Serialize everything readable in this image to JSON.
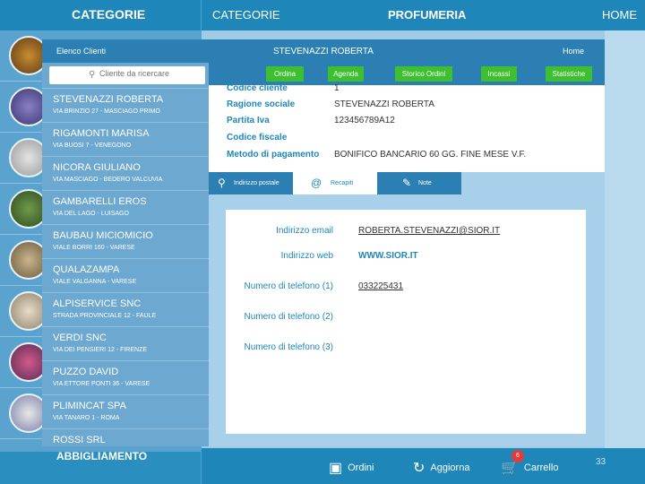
{
  "topbar": {
    "categorie_left": "CATEGORIE",
    "categorie": "CATEGORIE",
    "section": "PROFUMERIA",
    "home": "HOME"
  },
  "category_bottom": "ABBIGLIAMENTO",
  "client_list": {
    "title": "Elenco Clienti",
    "search_placeholder": "Cliente da ricercare",
    "clients": [
      {
        "name": "STEVENAZZI ROBERTA",
        "address": "VIA BRINZIO 27 - MASCIAGO PRIMO"
      },
      {
        "name": "RIGAMONTI MARISA",
        "address": "VIA BUOSI 7 - VENEGONO"
      },
      {
        "name": "NICORA GIULIANO",
        "address": "VIA MASCIAGO - BEDERO VALCUVIA"
      },
      {
        "name": "GAMBARELLI EROS",
        "address": "VIA DEL LAGO - LUISAGO"
      },
      {
        "name": "BAUBAU MICIOMICIO",
        "address": "VIALE BORRI 160 - VARESE"
      },
      {
        "name": "QUALAZAMPA",
        "address": "VIALE VALGANNA - VARESE"
      },
      {
        "name": "ALPISERVICE SNC",
        "address": "STRADA PROVINCIALE 12 - FAULE"
      },
      {
        "name": "VERDI SNC",
        "address": "VIA DEI PENSIERI 12 - FIRENZE"
      },
      {
        "name": "PUZZO DAVID",
        "address": "VIA ETTORE PONTI 36 - VARESE"
      },
      {
        "name": "PLIMINCAT SPA",
        "address": "VIA TANARO 1 - ROMA"
      },
      {
        "name": "ROSSI SRL",
        "address": ""
      }
    ]
  },
  "detail": {
    "title": "STEVENAZZI ROBERTA",
    "home": "Home",
    "toolbar": [
      "Ordina",
      "Agenda",
      "Storico Ordini",
      "Incassi",
      "Statistiche"
    ],
    "fields": [
      {
        "label": "Codice cliente",
        "value": "1"
      },
      {
        "label": "Ragione sociale",
        "value": "STEVENAZZI ROBERTA"
      },
      {
        "label": "Partita Iva",
        "value": "123456789A12"
      },
      {
        "label": "Codice fiscale",
        "value": ""
      },
      {
        "label": "Metodo di pagamento",
        "value": "BONIFICO BANCARIO 60 GG. FINE MESE V.F."
      }
    ],
    "tabs": [
      {
        "label": "Indirizzo postale",
        "icon": "pin-icon"
      },
      {
        "label": "Recapiti",
        "icon": "at-icon"
      },
      {
        "label": "Note",
        "icon": "note-icon"
      }
    ],
    "contacts": [
      {
        "label": "Indirizzo email",
        "value": "ROBERTA.STEVENAZZI@SIOR.IT"
      },
      {
        "label": "Indirizzo web",
        "value": "WWW.SIOR.IT"
      },
      {
        "label": "Numero di telefono (1)",
        "value": "033225431"
      },
      {
        "label": "Numero di telefono (2)",
        "value": ""
      },
      {
        "label": "Numero di telefono (3)",
        "value": ""
      }
    ]
  },
  "bottombar": {
    "ordini": "Ordini",
    "aggiorna": "Aggiorna",
    "carrello": "Carrello",
    "cart_count": "6",
    "page_number": "33"
  },
  "colors": {
    "brand_blue": "#1f86b9",
    "button_green": "#3dbf2f",
    "badge_red": "#e63b3b"
  }
}
